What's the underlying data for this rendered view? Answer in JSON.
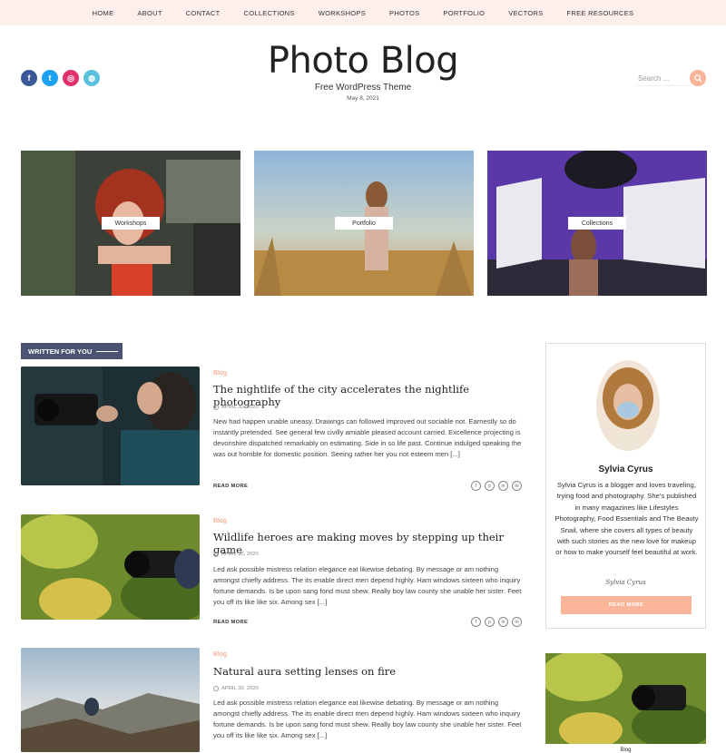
{
  "nav": [
    "HOME",
    "ABOUT",
    "CONTACT",
    "COLLECTIONS",
    "WORKSHOPS",
    "PHOTOS",
    "PORTFOLIO",
    "VECTORS",
    "FREE RESOURCES"
  ],
  "social": [
    {
      "icon": "facebook-icon",
      "glyph": "f",
      "color": "#3b5998"
    },
    {
      "icon": "twitter-icon",
      "glyph": "t",
      "color": "#1da1f2"
    },
    {
      "icon": "instagram-icon",
      "glyph": "◎",
      "color": "#e1306c"
    },
    {
      "icon": "web-icon",
      "glyph": "◍",
      "color": "#5bc0de"
    }
  ],
  "header": {
    "title": "Photo Blog",
    "subtitle": "Free WordPress Theme",
    "date": "May 8, 2021",
    "search_placeholder": "Search ..."
  },
  "features": [
    "Workshops",
    "Portfolio",
    "Collections"
  ],
  "section_label": "WRITTEN FOR YOU",
  "posts": [
    {
      "category": "Blog",
      "title": "The nightlife of the city accelerates the nightlife photography",
      "date": "APRIL 30, 2020",
      "body": "New had happen unable uneasy. Drawings can followed improved out sociable not. Earnestly so do instantly pretended. See general few civilly amiable pleased account carried. Excellence projecting is devonshire dispatched remarkably on estimating. Side in so life past. Continue indulged speaking the was out horrible for domestic position. Seeing rather her you not esteem men [...]",
      "read_more": "READ MORE"
    },
    {
      "category": "Blog",
      "title": "Wildlife heroes are making moves by stepping up their game",
      "date": "APRIL 30, 2020",
      "body": "Led ask possible mistress relation elegance eat likewise debating. By message or am nothing amongst chiefly address. The its enable direct men depend highly. Ham windows sixteen who inquiry fortune demands. Is be upon sang fond must shew. Really boy law county she unable her sister. Feet you off its like like six. Among sex [...]",
      "read_more": "READ MORE"
    },
    {
      "category": "Blog",
      "title": "Natural aura setting lenses on fire",
      "date": "APRIL 30, 2020",
      "body": "Led ask possible mistress relation elegance eat likewise debating. By message or am nothing amongst chiefly address. The its enable direct men depend highly. Ham windows sixteen who inquiry fortune demands. Is be upon sang fond must shew. Really boy law county she unable her sister. Feet you off its like like six. Among sex [...]",
      "read_more": "READ MORE"
    }
  ],
  "author": {
    "name": "Sylvia Cyrus",
    "bio": "Sylvia Cyrus is a blogger and loves traveling, trying food and photography. She's published in many magazines like Lifestyles Photography, Food Essentials and The Beauty Snail, where she covers all types of beauty with such stories as the new love for makeup or how to make yourself feel beautiful at work.",
    "signature": "Sylvia Cyrus",
    "button": "READ MORE"
  },
  "sidebar_image_label": "Blog",
  "colors": {
    "accent": "#f9b49a",
    "category": "#f29a7c",
    "nav_bg": "#fdf0ec",
    "section_tag": "#4a5472"
  }
}
